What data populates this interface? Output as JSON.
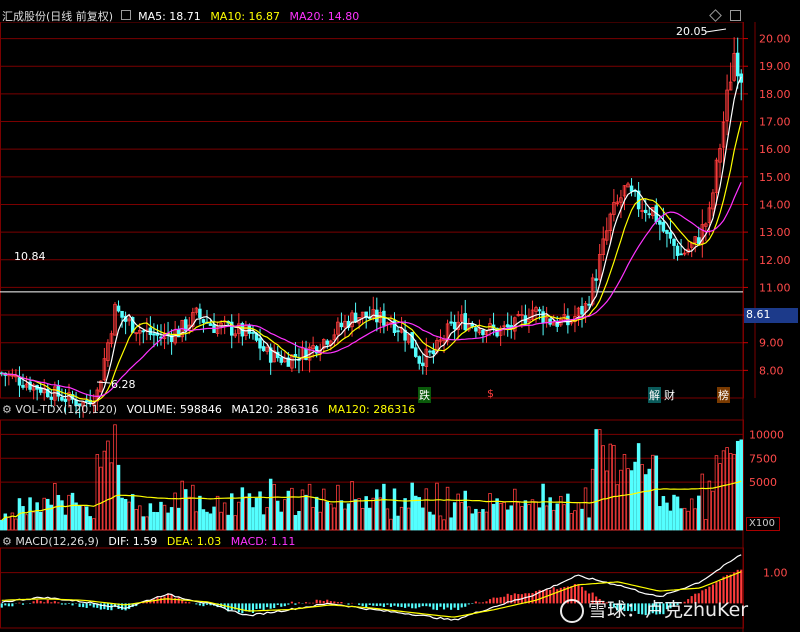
{
  "header": {
    "stock_name": "汇成股份(日线 前复权)",
    "ma5_label": "MA5: 18.71",
    "ma10_label": "MA10: 16.87",
    "ma20_label": "MA20: 14.80"
  },
  "annotations": {
    "high_label": "20.05",
    "low_label": "6.28",
    "hline_label": "10.84",
    "current_price": "8.61",
    "markers": [
      "跌",
      "$",
      "解",
      "财",
      "榜"
    ]
  },
  "volume_header": {
    "indicator": "VOL-TDX(120,120)",
    "volume_label": "VOLUME: 598846",
    "ma120_a": "MA120: 286316",
    "ma120_b": "MA120: 286316",
    "unit": "X100"
  },
  "macd_header": {
    "indicator": "MACD(12,26,9)",
    "dif_label": "DIF: 1.59",
    "dea_label": "DEA: 1.03",
    "macd_label": "MACD: 1.11"
  },
  "watermark": "雪球：卢克zhuKer",
  "colors": {
    "up": "#ff3c3c",
    "down": "#54ffff",
    "ma5": "#ffffff",
    "ma10": "#ffff00",
    "ma20": "#ff33ff",
    "grid": "#7a0000"
  },
  "chart_data": [
    {
      "type": "candlestick",
      "price_axis_ticks": [
        8.0,
        9.0,
        10.0,
        11.0,
        12.0,
        13.0,
        14.0,
        15.0,
        16.0,
        17.0,
        18.0,
        19.0,
        20.0
      ],
      "ylim": [
        7.0,
        20.6
      ],
      "close_path": [
        [
          0,
          7.9
        ],
        [
          6,
          7.6
        ],
        [
          12,
          7.3
        ],
        [
          18,
          7.0
        ],
        [
          23,
          6.8
        ],
        [
          27,
          7.2
        ],
        [
          30,
          9.0
        ],
        [
          32,
          10.2
        ],
        [
          35,
          9.8
        ],
        [
          40,
          9.4
        ],
        [
          45,
          9.2
        ],
        [
          50,
          9.4
        ],
        [
          55,
          10.0
        ],
        [
          60,
          9.6
        ],
        [
          65,
          9.5
        ],
        [
          70,
          9.3
        ],
        [
          75,
          8.6
        ],
        [
          80,
          8.4
        ],
        [
          85,
          8.6
        ],
        [
          90,
          9.0
        ],
        [
          95,
          9.5
        ],
        [
          100,
          10.0
        ],
        [
          105,
          9.9
        ],
        [
          110,
          9.8
        ],
        [
          115,
          9.2
        ],
        [
          118,
          8.4
        ],
        [
          122,
          8.6
        ],
        [
          126,
          9.4
        ],
        [
          130,
          9.8
        ],
        [
          135,
          9.6
        ],
        [
          140,
          9.4
        ],
        [
          145,
          9.6
        ],
        [
          150,
          10.2
        ],
        [
          155,
          9.8
        ],
        [
          160,
          9.7
        ],
        [
          165,
          10.3
        ],
        [
          168,
          11.5
        ],
        [
          172,
          13.5
        ],
        [
          176,
          14.5
        ],
        [
          180,
          14.0
        ],
        [
          184,
          13.8
        ],
        [
          188,
          12.8
        ],
        [
          192,
          12.2
        ],
        [
          196,
          12.6
        ],
        [
          200,
          13.6
        ],
        [
          204,
          17.0
        ],
        [
          207,
          19.5
        ],
        [
          209,
          18.7
        ]
      ],
      "high": 20.05,
      "low": 6.28,
      "reference_line": 10.84
    },
    {
      "type": "bar",
      "name": "volume",
      "axis_ticks": [
        5000,
        7500,
        10000
      ],
      "ylim": [
        0,
        11500
      ]
    },
    {
      "type": "line",
      "name": "macd",
      "axis_ticks": [
        1.0
      ],
      "series": [
        {
          "name": "DIF",
          "values": [
            0.05,
            0.2,
            0.05,
            -0.15,
            0.3,
            0.0,
            -0.4,
            -0.2,
            0.0,
            -0.2,
            -0.35,
            -0.55,
            -0.1,
            0.3,
            0.9,
            0.6,
            0.2,
            0.7,
            1.59
          ]
        },
        {
          "name": "DEA",
          "values": [
            0.1,
            0.15,
            0.1,
            -0.05,
            0.15,
            0.05,
            -0.25,
            -0.2,
            -0.05,
            -0.15,
            -0.3,
            -0.45,
            -0.2,
            0.1,
            0.6,
            0.7,
            0.4,
            0.5,
            1.03
          ]
        }
      ]
    }
  ]
}
